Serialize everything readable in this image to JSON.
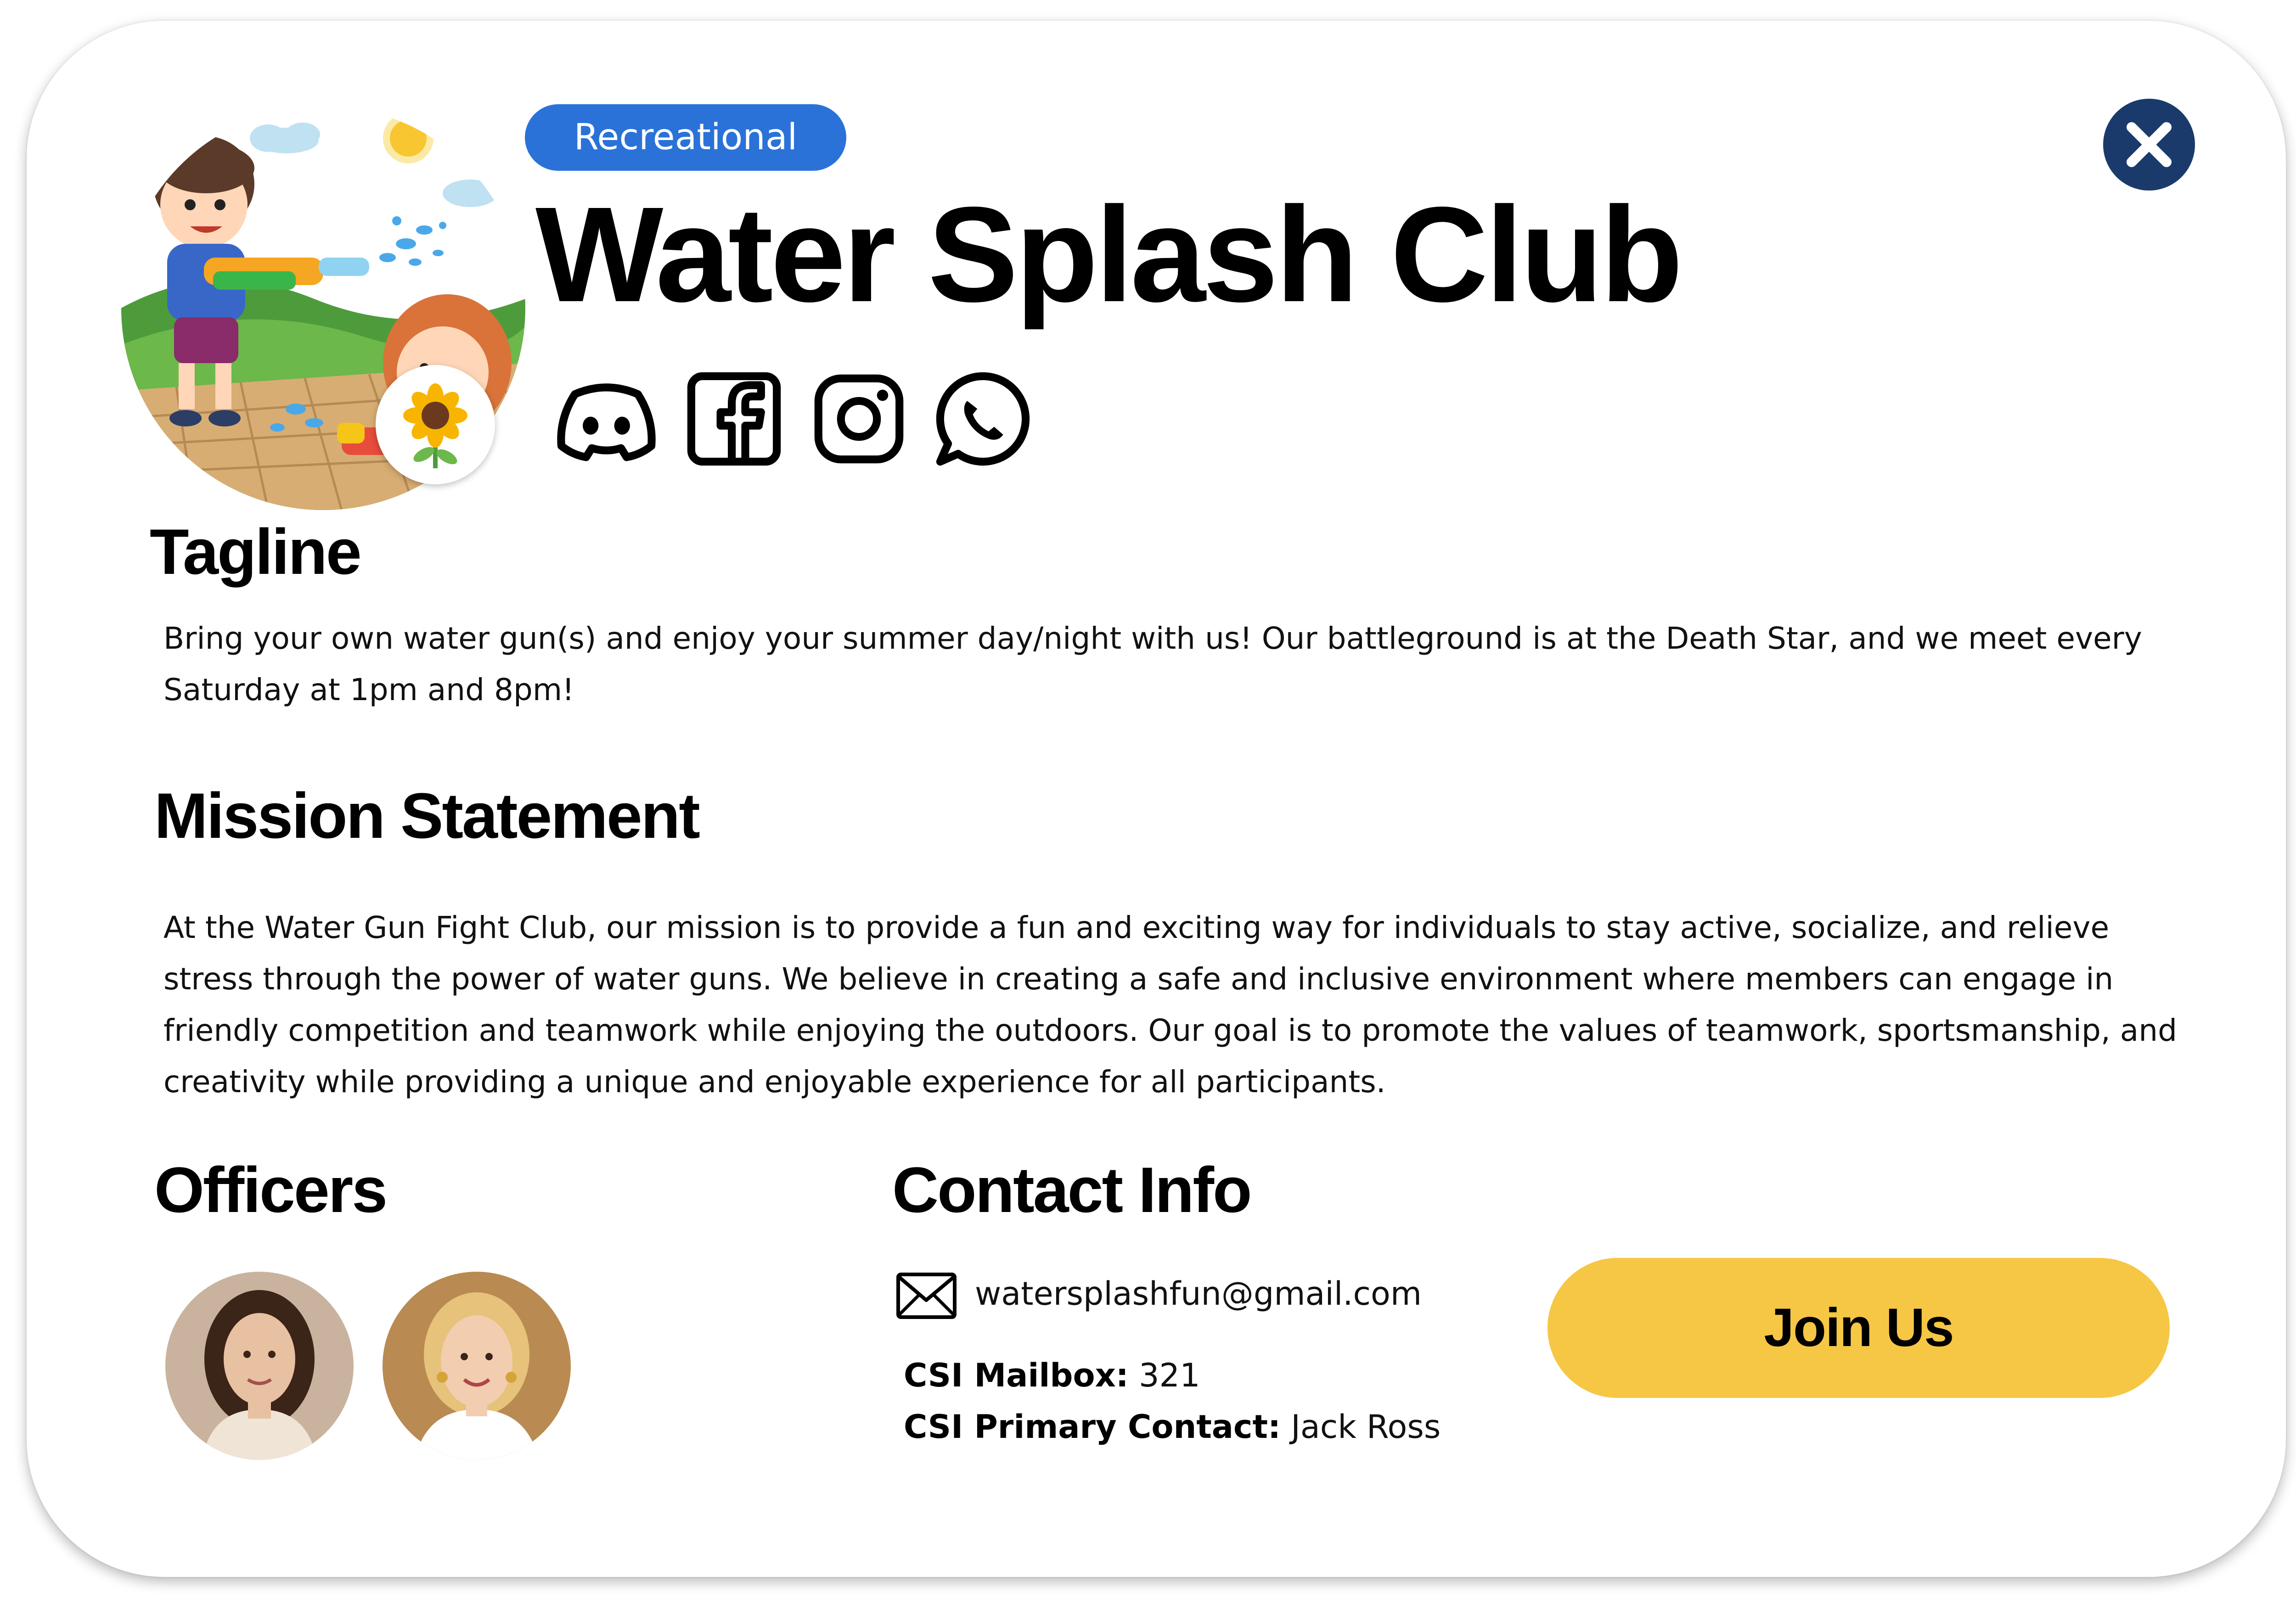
{
  "club": {
    "category": "Recreational",
    "name": "Water Splash Club"
  },
  "social": [
    "discord-icon",
    "facebook-icon",
    "instagram-icon",
    "whatsapp-icon"
  ],
  "sections": {
    "tagline": {
      "heading": "Tagline",
      "text": "Bring your own water gun(s) and enjoy your summer day/night with us! Our battleground is at the Death Star, and we meet every Saturday at 1pm and 8pm!"
    },
    "mission": {
      "heading": "Mission Statement",
      "text": "At the Water Gun Fight Club, our mission is to provide a fun and exciting way for individuals to stay active, socialize, and relieve stress through the power of water guns. We believe in creating a safe and inclusive environment where members can engage in friendly competition and teamwork while enjoying the outdoors. Our goal is to promote the values of teamwork, sportsmanship, and creativity while providing a unique and enjoyable experience for all participants."
    },
    "officers": {
      "heading": "Officers"
    },
    "contact": {
      "heading": "Contact Info",
      "email": "watersplashfun@gmail.com",
      "mailbox_label": "CSI Mailbox:",
      "mailbox_value": "321",
      "primary_label": "CSI Primary Contact:",
      "primary_value": "Jack Ross"
    }
  },
  "actions": {
    "join": "Join Us"
  },
  "colors": {
    "badge": "#2a72d8",
    "close_button": "#1a3a6b",
    "join_button": "#f6c645"
  }
}
